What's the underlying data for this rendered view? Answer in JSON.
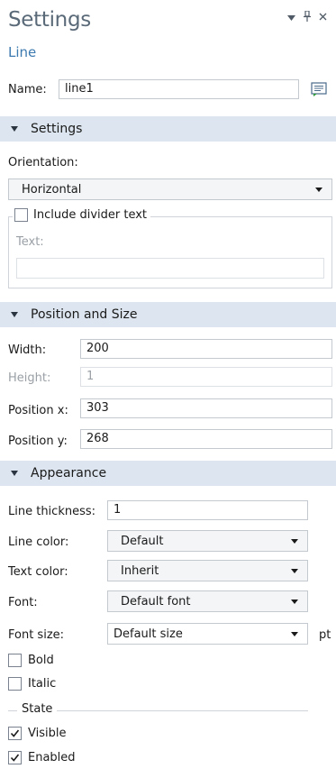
{
  "header": {
    "title": "Settings",
    "subtitle": "Line",
    "controls": [
      "chevron-down-icon",
      "pin-icon",
      "close-icon"
    ]
  },
  "name_row": {
    "label": "Name:",
    "value": "line1",
    "icon": "edit-note-icon"
  },
  "sections": {
    "settings": {
      "title": "Settings",
      "orientation_label": "Orientation:",
      "orientation_value": "Horizontal",
      "include_divider": {
        "label": "Include divider text",
        "checked": false
      },
      "text_label": "Text:",
      "text_value": ""
    },
    "position_size": {
      "title": "Position and Size",
      "width": {
        "label": "Width:",
        "value": "200"
      },
      "height": {
        "label": "Height:",
        "value": "1"
      },
      "position_x": {
        "label": "Position x:",
        "value": "303"
      },
      "position_y": {
        "label": "Position y:",
        "value": "268"
      }
    },
    "appearance": {
      "title": "Appearance",
      "line_thickness": {
        "label": "Line thickness:",
        "value": "1"
      },
      "line_color": {
        "label": "Line color:",
        "value": "Default"
      },
      "text_color": {
        "label": "Text color:",
        "value": "Inherit"
      },
      "font": {
        "label": "Font:",
        "value": "Default font"
      },
      "font_size": {
        "label": "Font size:",
        "value": "Default size",
        "unit": "pt"
      },
      "bold": {
        "label": "Bold",
        "checked": false
      },
      "italic": {
        "label": "Italic",
        "checked": false
      },
      "state_label": "State",
      "visible": {
        "label": "Visible",
        "checked": true
      },
      "enabled": {
        "label": "Enabled",
        "checked": true
      }
    }
  },
  "colors": {
    "section_bg": "#dde6f0",
    "subtitle": "#3d7ab0",
    "title": "#5a6a78"
  }
}
